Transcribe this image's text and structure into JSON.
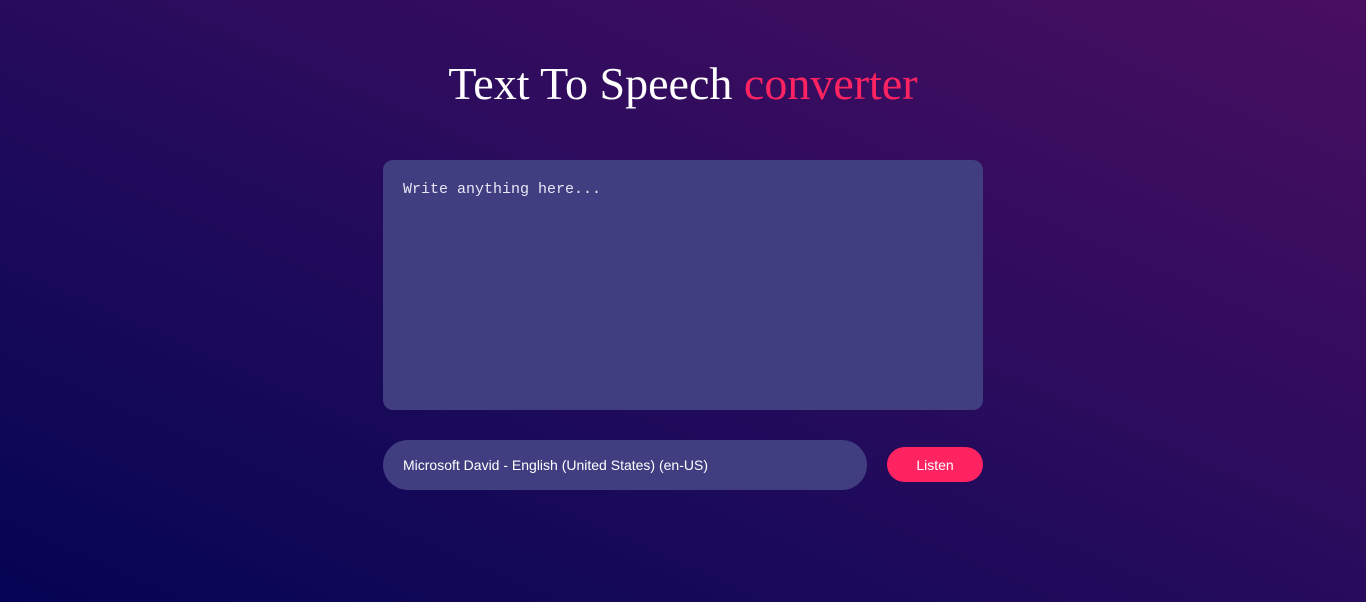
{
  "header": {
    "title_main": "Text To Speech",
    "title_accent": "converter"
  },
  "editor": {
    "value": "",
    "placeholder": "Write anything here..."
  },
  "controls": {
    "voice_selected": "Microsoft David - English (United States) (en-US)",
    "listen_label": "Listen"
  },
  "colors": {
    "accent": "#ff2362",
    "panel": "#403d80",
    "background_start": "#050454",
    "background_end": "#490e60"
  }
}
